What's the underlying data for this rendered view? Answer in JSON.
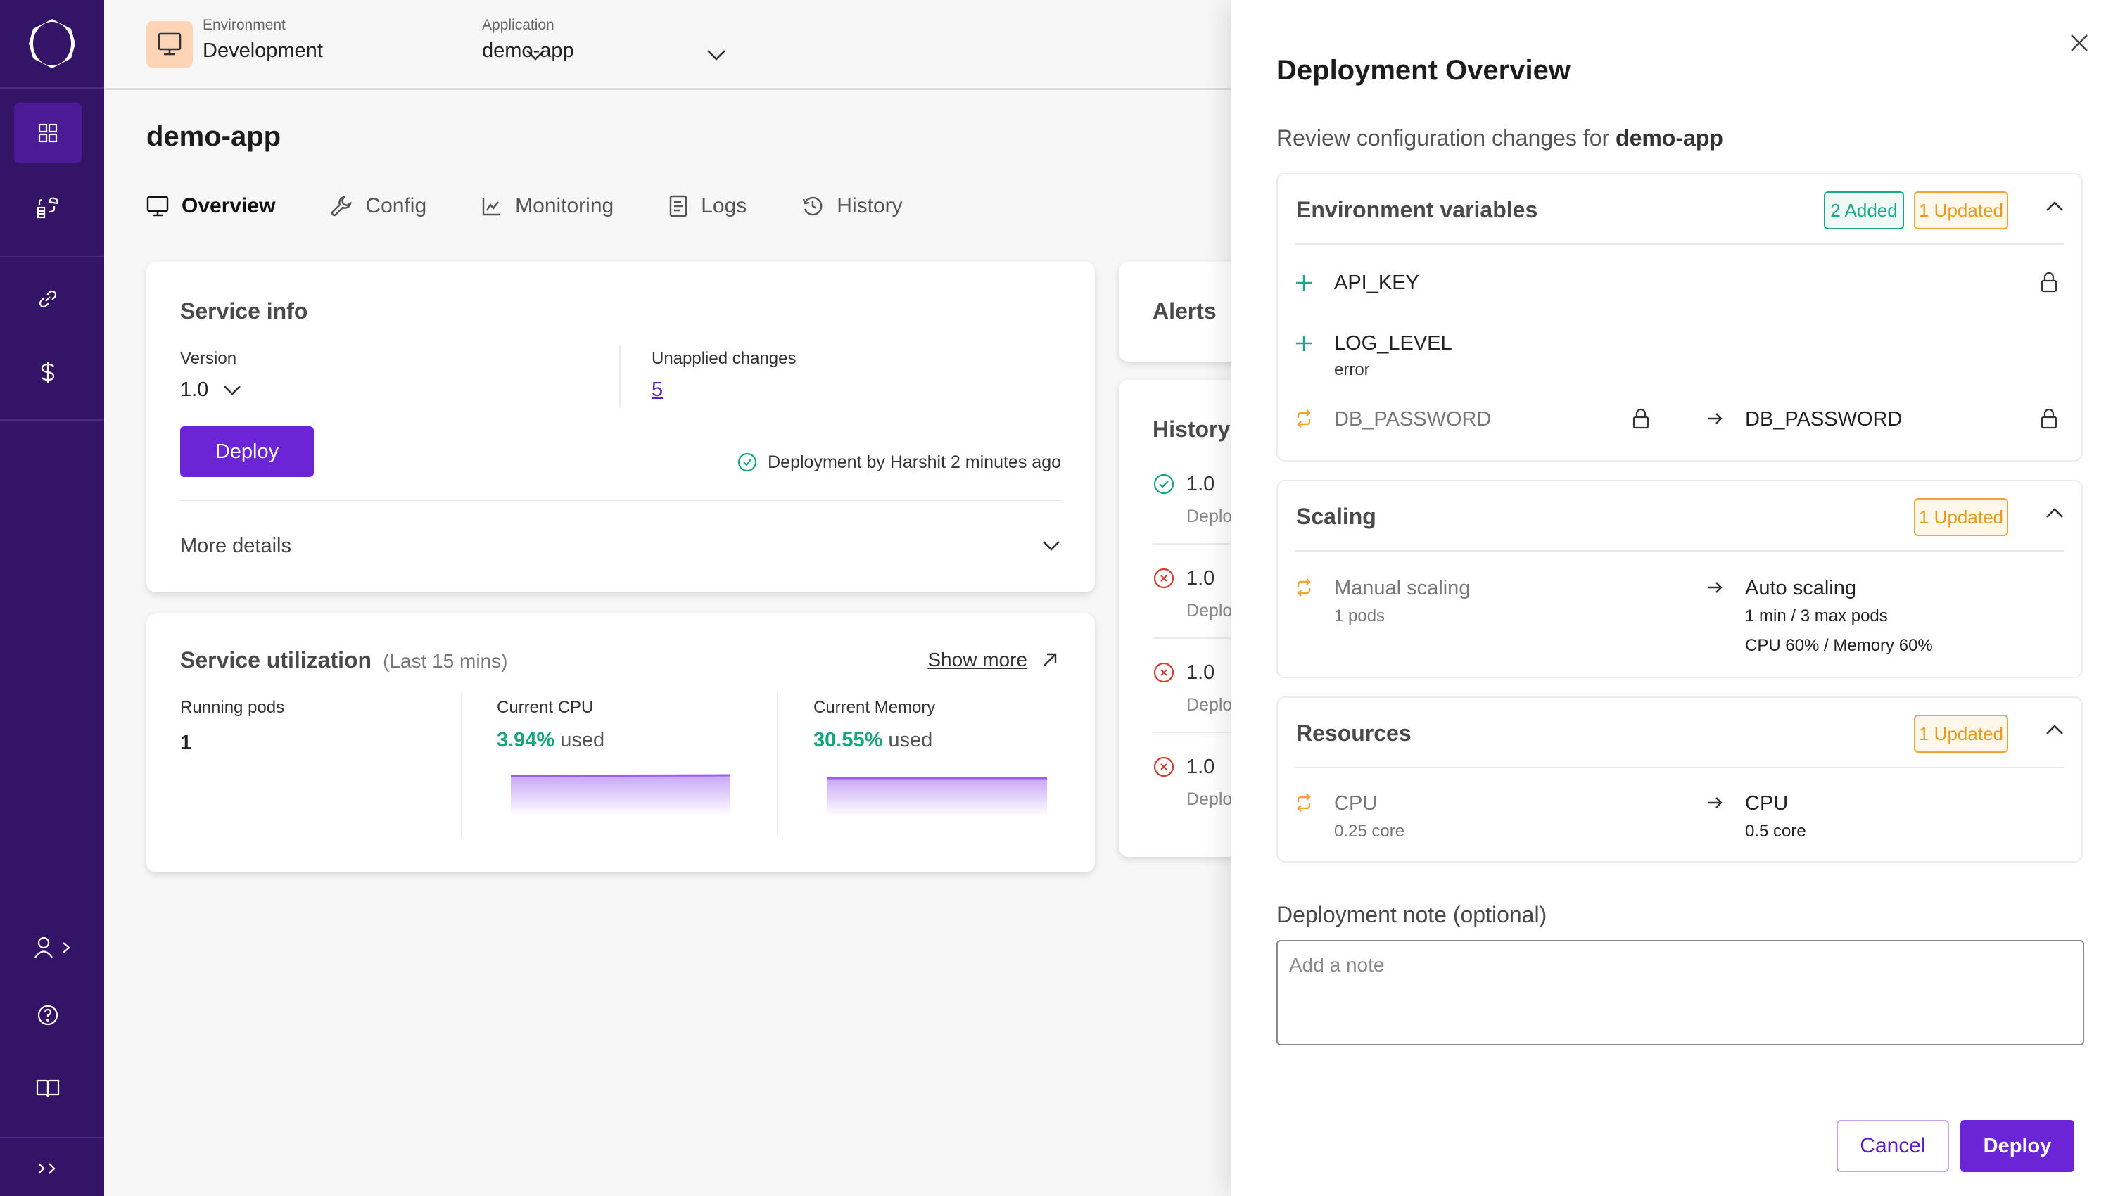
{
  "sidebar": {
    "items": [
      {
        "name": "dashboard",
        "icon": "grid-icon",
        "active": true
      },
      {
        "name": "services",
        "icon": "cloud-database-icon",
        "active": false
      },
      {
        "name": "integrations",
        "icon": "link-icon",
        "active": false
      },
      {
        "name": "billing",
        "icon": "dollar-icon",
        "active": false
      }
    ],
    "bottom": [
      {
        "name": "account",
        "icon": "user-icon"
      },
      {
        "name": "help",
        "icon": "help-circle-icon"
      },
      {
        "name": "docs",
        "icon": "book-icon"
      },
      {
        "name": "expand",
        "icon": "chevrons-right-icon"
      }
    ]
  },
  "header": {
    "environment": {
      "label": "Environment",
      "value": "Development"
    },
    "application": {
      "label": "Application",
      "value": "demo-app"
    }
  },
  "page": {
    "title": "demo-app",
    "tabs": [
      {
        "label": "Overview",
        "icon": "monitor-icon",
        "active": true
      },
      {
        "label": "Config",
        "icon": "wrench-icon",
        "active": false
      },
      {
        "label": "Monitoring",
        "icon": "chart-line-icon",
        "active": false
      },
      {
        "label": "Logs",
        "icon": "file-text-icon",
        "active": false
      },
      {
        "label": "History",
        "icon": "history-icon",
        "active": false
      }
    ]
  },
  "service_info": {
    "title": "Service info",
    "version_label": "Version",
    "version_value": "1.0",
    "unapplied_label": "Unapplied changes",
    "unapplied_value": "5",
    "deploy_label": "Deploy",
    "last_deployment": "Deployment by Harshit 2 minutes ago",
    "more_details": "More details"
  },
  "utilization": {
    "title": "Service utilization",
    "subtitle": "(Last 15 mins)",
    "show_more": "Show more",
    "running_pods_label": "Running pods",
    "running_pods_value": "1",
    "cpu_label": "Current CPU",
    "cpu_value": "3.94%",
    "cpu_suffix": "used",
    "memory_label": "Current Memory",
    "memory_value": "30.55%",
    "memory_suffix": "used"
  },
  "alerts": {
    "title": "Alerts"
  },
  "history": {
    "title": "History",
    "items": [
      {
        "status": "success",
        "version": "1.0",
        "text": "Deplo"
      },
      {
        "status": "failed",
        "version": "1.0",
        "text": "Deplo"
      },
      {
        "status": "failed",
        "version": "1.0",
        "text": "Deplo"
      },
      {
        "status": "failed",
        "version": "1.0",
        "text": "Deplo"
      }
    ]
  },
  "drawer": {
    "title": "Deployment Overview",
    "subtitle_prefix": "Review configuration changes for ",
    "subtitle_app": "demo-app",
    "sections": {
      "env": {
        "title": "Environment variables",
        "badge_added": "2 Added",
        "badge_updated": "1 Updated",
        "rows": [
          {
            "type": "added",
            "name": "API_KEY",
            "secret": true
          },
          {
            "type": "added",
            "name": "LOG_LEVEL",
            "value": "error"
          },
          {
            "type": "updated",
            "old_name": "DB_PASSWORD",
            "new_name": "DB_PASSWORD",
            "secret": true
          }
        ]
      },
      "scaling": {
        "title": "Scaling",
        "badge_updated": "1 Updated",
        "old_title": "Manual scaling",
        "old_sub": "1 pods",
        "new_title": "Auto scaling",
        "new_sub1": "1 min / 3 max pods",
        "new_sub2": "CPU 60% / Memory 60%"
      },
      "resources": {
        "title": "Resources",
        "badge_updated": "1 Updated",
        "old_title": "CPU",
        "old_sub": "0.25 core",
        "new_title": "CPU",
        "new_sub": "0.5 core"
      }
    },
    "note_label": "Deployment note (optional)",
    "note_placeholder": "Add a note",
    "note_value": "",
    "cancel_label": "Cancel",
    "deploy_label": "Deploy"
  },
  "colors": {
    "sidebar": "#341466",
    "primary": "#6b24d6",
    "added": "#1aa88a",
    "updated": "#f0a535",
    "success": "#13a77a",
    "error": "#d93a2f"
  }
}
